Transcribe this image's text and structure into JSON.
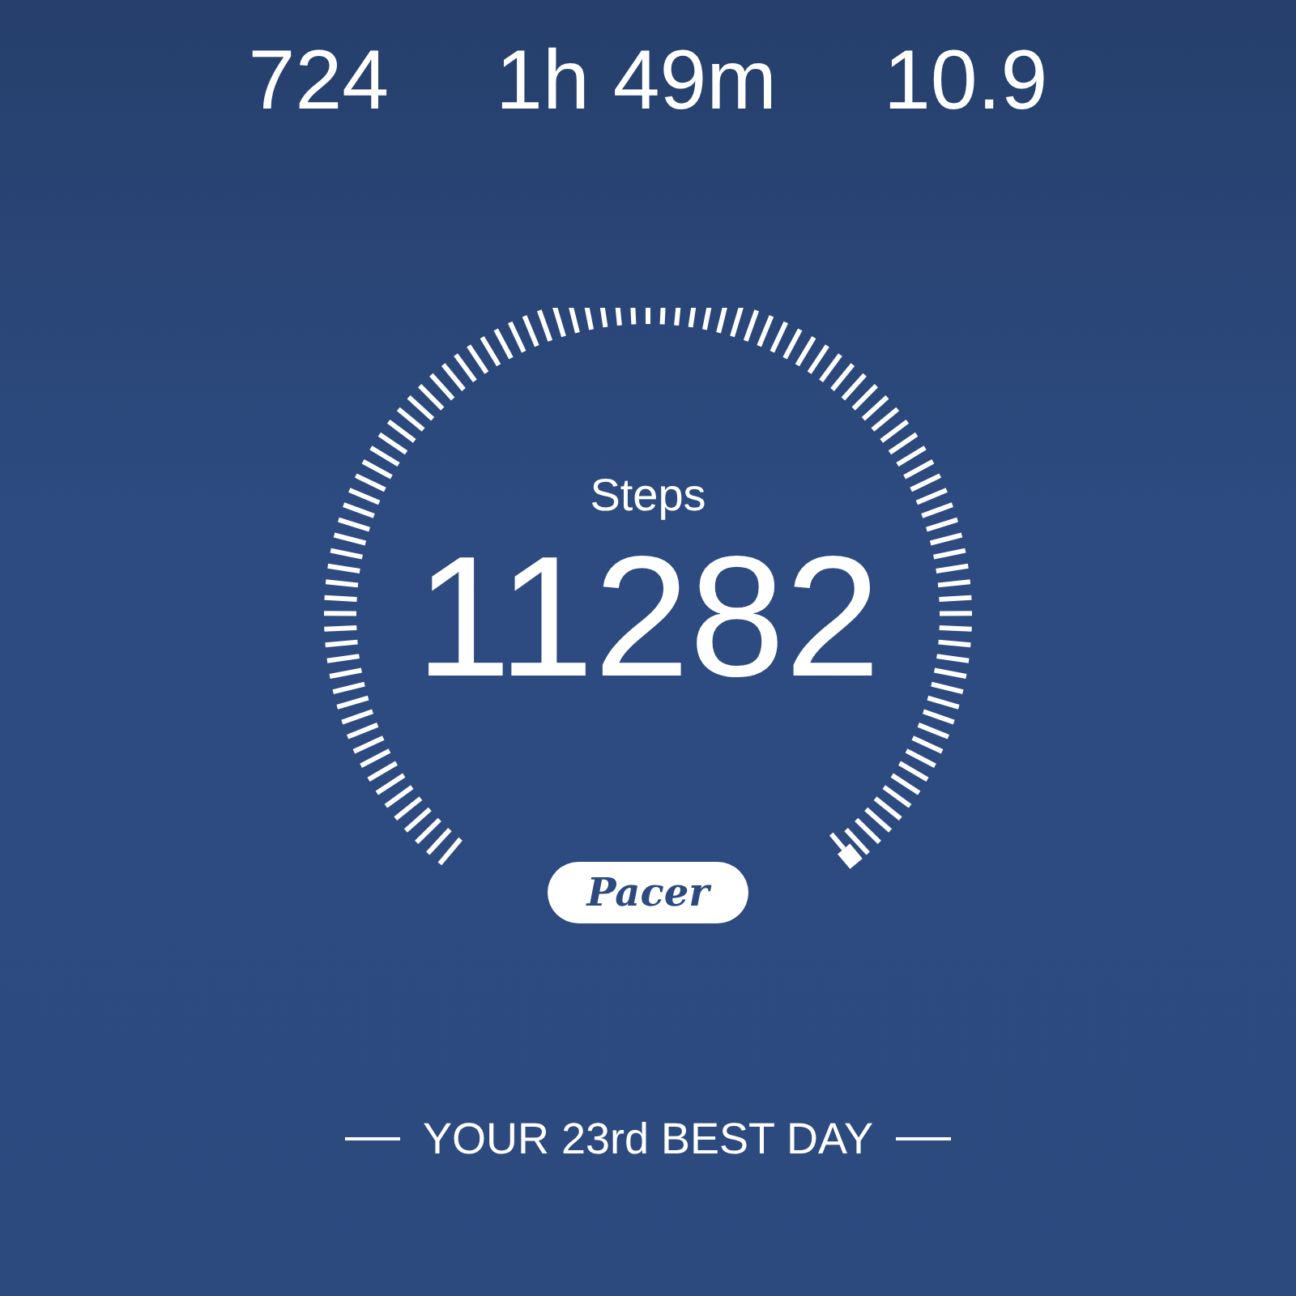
{
  "stats": [
    {
      "value": "724"
    },
    {
      "value": "1h 49m"
    },
    {
      "value": "10.9"
    }
  ],
  "gauge": {
    "label": "Steps",
    "value": "11282"
  },
  "logo": "Pacer",
  "footer": "YOUR 23rd BEST DAY"
}
